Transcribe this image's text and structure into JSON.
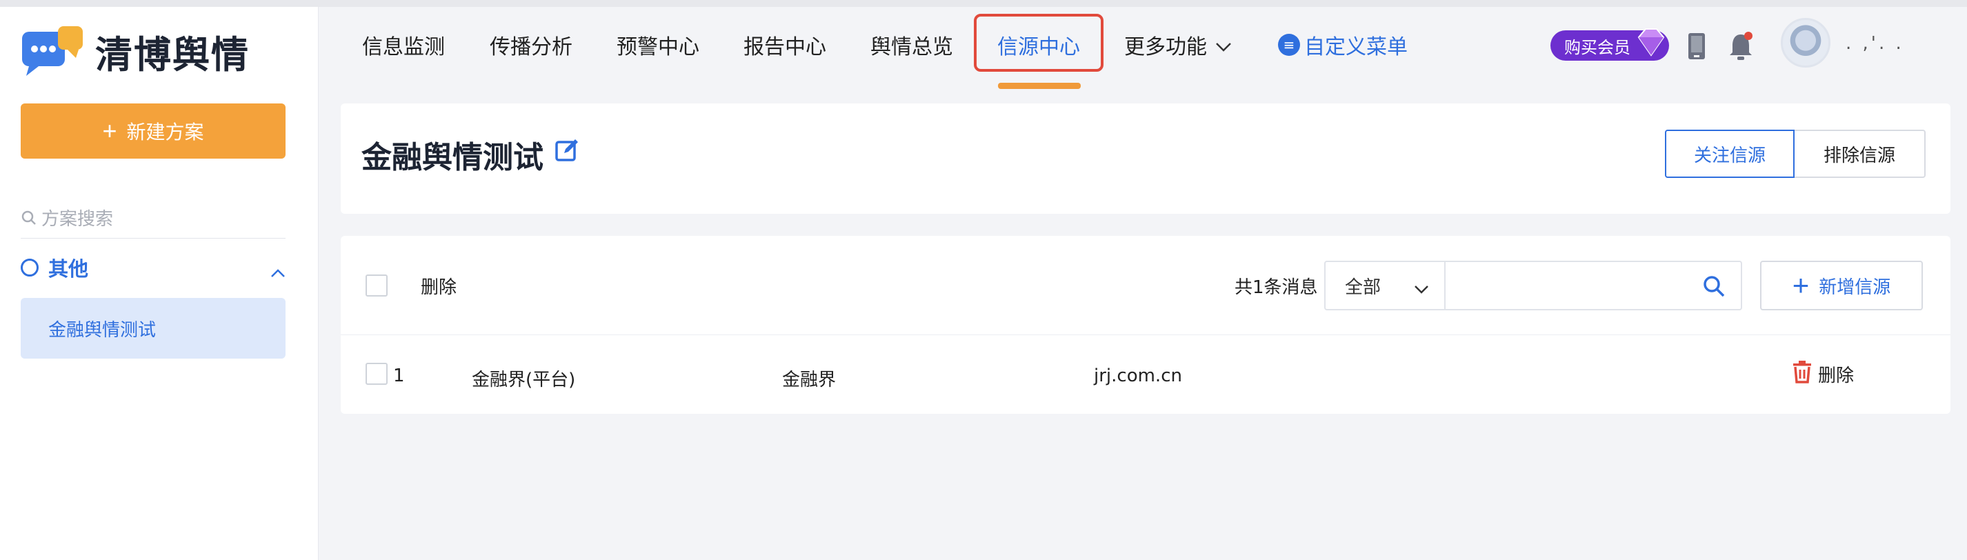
{
  "brand": {
    "name": "清博舆情"
  },
  "sidebar": {
    "new_plan_label": "新建方案",
    "search_placeholder": "方案搜索",
    "group_label": "其他",
    "plan_item": "金融舆情测试"
  },
  "nav": {
    "items": [
      "信息监测",
      "传播分析",
      "预警中心",
      "报告中心",
      "舆情总览",
      "信源中心",
      "更多功能",
      "自定义菜单"
    ],
    "active": "信源中心",
    "vip_label": "购买会员",
    "username": ". ,'. ."
  },
  "page": {
    "title": "金融舆情测试",
    "follow_button": "关注信源",
    "exclude_button": "排除信源"
  },
  "toolbar": {
    "delete_label": "删除",
    "count_text": "共1条消息",
    "filter_value": "全部",
    "search_value": "",
    "add_button": "新增信源"
  },
  "rows": [
    {
      "index": "1",
      "name": "金融界(平台)",
      "site": "金融界",
      "domain": "jrj.com.cn",
      "delete_label": "删除"
    }
  ],
  "colors": {
    "accent": "#2f6fde",
    "orange": "#f4a23b",
    "highlight": "#e14a3c",
    "vip": "#6d2fcf"
  }
}
